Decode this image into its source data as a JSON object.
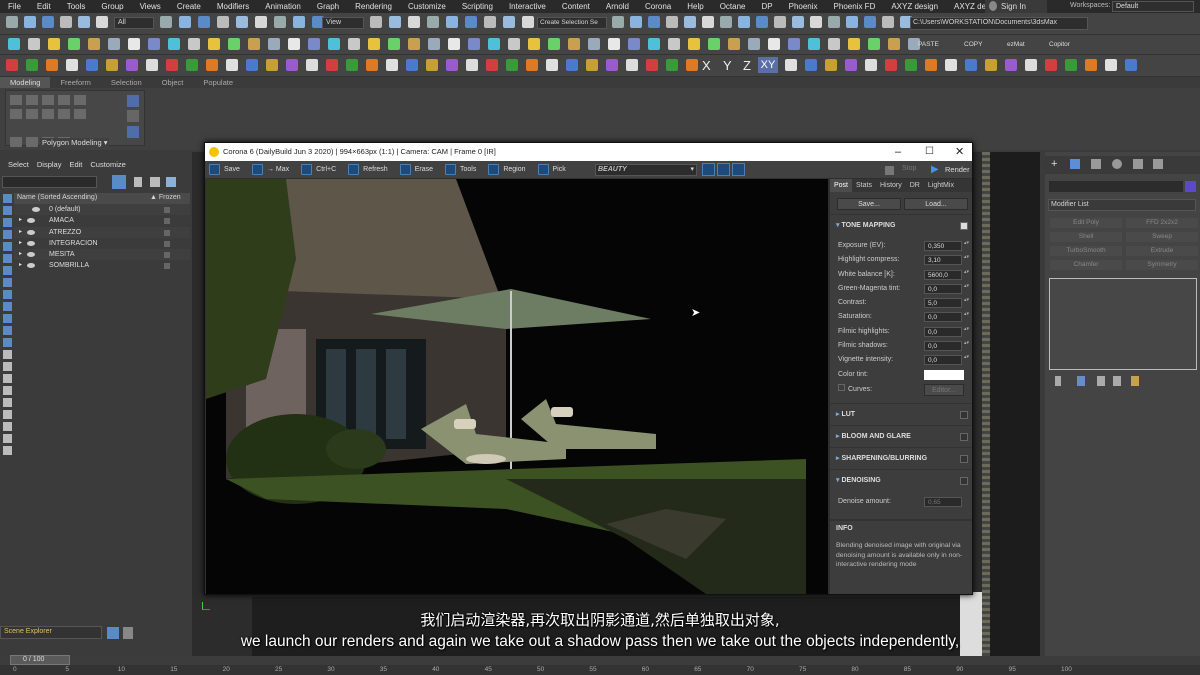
{
  "menu": [
    "File",
    "Edit",
    "Tools",
    "Group",
    "Views",
    "Create",
    "Modifiers",
    "Animation",
    "Graph",
    "Rendering",
    "Customize",
    "Scripting",
    "Interactive",
    "Content",
    "Arnold",
    "Corona",
    "Help",
    "Octane",
    "DP",
    "Phoenix",
    "Phoenix FD",
    "AXYZ design",
    "AXYZ design"
  ],
  "signin": "Sign In",
  "workspaces_label": "Workspaces:",
  "workspace_value": "Default",
  "toolbar1": {
    "filter": "All",
    "view": "View",
    "selection_set": "Create Selection Se",
    "path": "C:\\Users\\WORKSTATION\\Documents\\3dsMax"
  },
  "toolbar2_text": {
    "paste": "PASTE",
    "copy": "COPY",
    "ezmat": "ezMat",
    "copitor": "Copitor"
  },
  "toolbar3_axes": [
    "X",
    "Y",
    "Z",
    "XY"
  ],
  "ribbon_tabs": [
    "Modeling",
    "Freeform",
    "Selection",
    "Object Paint",
    "Populate"
  ],
  "ribbon_label": "Polygon Modeling ▾",
  "scene_menu": [
    "Select",
    "Display",
    "Edit",
    "Customize"
  ],
  "scene_headers": {
    "name": "Name (Sorted Ascending)",
    "frozen": "▲ Frozen"
  },
  "scene_rows": [
    "0 (default)",
    "AMACA",
    "ATREZZO",
    "INTEGRACION",
    "MESITA",
    "SOMBRILLA"
  ],
  "scene_explorer": "Scene Explorer",
  "timeline_pos": "0 / 100",
  "timeline_ticks": [
    "0",
    "5",
    "10",
    "15",
    "20",
    "25",
    "30",
    "35",
    "40",
    "45",
    "50",
    "55",
    "60",
    "65",
    "70",
    "75",
    "80",
    "85",
    "90",
    "95",
    "100"
  ],
  "corona": {
    "title": "Corona 6 (DailyBuild Jun  3 2020) | 994×663px (1:1) | Camera: CAM | Frame 0 [IR]",
    "toolbar": [
      "Save",
      "→ Max",
      "Ctrl+C",
      "Refresh",
      "Erase",
      "Tools",
      "Region",
      "Pick"
    ],
    "beauty": "BEAUTY",
    "stop": "Stop",
    "render": "Render",
    "tabs": [
      "Post",
      "Stats",
      "History",
      "DR",
      "LightMix"
    ],
    "save_btn": "Save...",
    "load_btn": "Load...",
    "tone_mapping": "TONE MAPPING",
    "params": [
      {
        "label": "Exposure (EV):",
        "value": "0,350"
      },
      {
        "label": "Highlight compress:",
        "value": "3,10"
      },
      {
        "label": "White balance [K]:",
        "value": "5600,0"
      },
      {
        "label": "Green-Magenta tint:",
        "value": "0,0"
      },
      {
        "label": "Contrast:",
        "value": "5,0"
      },
      {
        "label": "Saturation:",
        "value": "0,0"
      },
      {
        "label": "Filmic highlights:",
        "value": "0,0"
      },
      {
        "label": "Filmic shadows:",
        "value": "0,0"
      },
      {
        "label": "Vignette intensity:",
        "value": "0,0"
      }
    ],
    "color_tint": "Color tint:",
    "curves": "Curves:",
    "editor": "Editor...",
    "sections": [
      "LUT",
      "BLOOM AND GLARE",
      "SHARPENING/BLURRING",
      "DENOISING"
    ],
    "denoise_label": "Denoise amount:",
    "denoise_value": "0,65",
    "info_title": "INFO",
    "info_text": "Blending denoised image with original via denoising amount is available only in non-interactive rendering mode"
  },
  "modifier_list": "Modifier List",
  "modifier_buttons": [
    "Edit Poly",
    "FFD 2x2x2",
    "Shell",
    "Sweep",
    "TurboSmooth",
    "Extrude",
    "Chamfer",
    "Symmetry"
  ],
  "subtitle_zh": "我们启动渲染器,再次取出阴影通道,然后单独取出对象,",
  "subtitle_en": "we launch our renders and again we take out a shadow pass then we take out the objects independently,"
}
